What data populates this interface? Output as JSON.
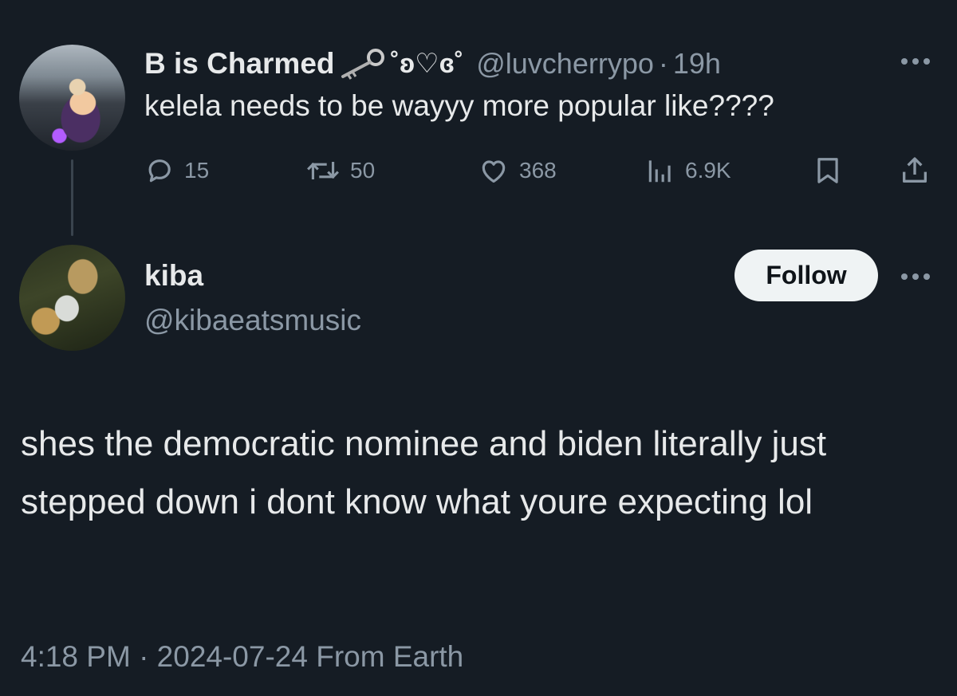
{
  "parent_tweet": {
    "display_name": "B is Charmed",
    "name_decoration": "˚ʚ♡ɞ˚",
    "handle": "@luvcherrypo",
    "separator": "·",
    "time_ago": "19h",
    "text": "kelela needs to be wayyy more popular like????",
    "actions": {
      "replies": "15",
      "reposts": "50",
      "likes": "368",
      "views": "6.9K"
    }
  },
  "reply_tweet": {
    "display_name": "kiba",
    "handle": "@kibaeatsmusic",
    "follow_label": "Follow",
    "text": "shes the democratic nominee and biden literally just stepped down i dont know what youre expecting lol",
    "timestamp": "4:18 PM · 2024-07-24 From Earth"
  },
  "icons": {
    "key": "key-icon",
    "more": "more-icon",
    "reply": "reply-icon",
    "repost": "repost-icon",
    "like": "heart-icon",
    "views": "views-icon",
    "bookmark": "bookmark-icon",
    "share": "share-icon"
  },
  "colors": {
    "background": "#151c24",
    "text_primary": "#e7e9ea",
    "text_secondary": "#8b98a5",
    "follow_button_bg": "#eff3f4",
    "thread_line": "#3a444e"
  }
}
